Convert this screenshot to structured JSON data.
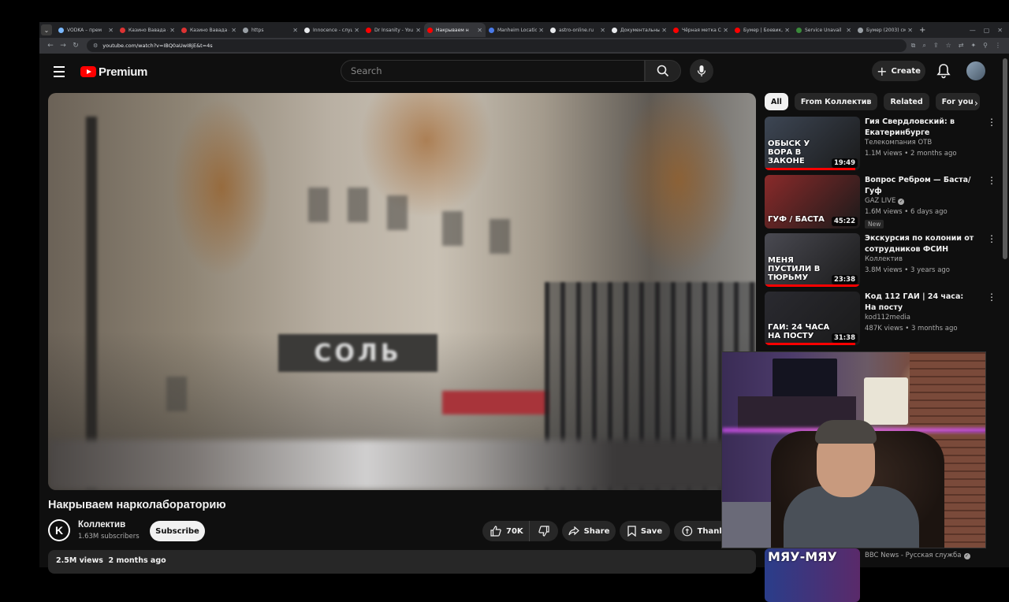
{
  "browser": {
    "tabs": [
      {
        "label": "VODKA – прем",
        "color": "#7ab8ff",
        "active": false
      },
      {
        "label": "Казино Вавада –",
        "color": "#d33",
        "active": false
      },
      {
        "label": "Казино Вавада –",
        "color": "#d33",
        "active": false
      },
      {
        "label": "https",
        "color": "#9aa0a6",
        "active": false
      },
      {
        "label": "Innocence - слуш",
        "color": "#e8eaed",
        "active": false
      },
      {
        "label": "Dr Insanity - You",
        "color": "#f00",
        "active": false
      },
      {
        "label": "Накрываем н",
        "color": "#f00",
        "active": true
      },
      {
        "label": "Manheim Locatio",
        "color": "#4a7ae8",
        "active": false
      },
      {
        "label": "astro-online.ru",
        "color": "#e8eaed",
        "active": false
      },
      {
        "label": "Документальны",
        "color": "#e8eaed",
        "active": false
      },
      {
        "label": "Чёрная метка С",
        "color": "#f00",
        "active": false
      },
      {
        "label": "Бумер | Боевик,",
        "color": "#f00",
        "active": false
      },
      {
        "label": "Service Unavail",
        "color": "#3a8a3a",
        "active": false
      },
      {
        "label": "Бумер (2003) см",
        "color": "#9aa0a6",
        "active": false
      }
    ],
    "url": "youtube.com/watch?v=IBQ0aUwI8jE&t=4s"
  },
  "header": {
    "logo_text": "Premium",
    "search_placeholder": "Search",
    "create_label": "Create"
  },
  "video": {
    "title": "Накрываем нарколабораторию",
    "sign_text": "СОЛЬ",
    "channel": "Коллектив",
    "channel_initial": "K",
    "subscribers": "1.63M subscribers",
    "subscribe_label": "Subscribe",
    "likes": "70K",
    "share_label": "Share",
    "save_label": "Save",
    "thanks_label": "Thanks",
    "views": "2.5M views",
    "age": "2 months ago"
  },
  "chips": [
    "All",
    "From Коллектив",
    "Related",
    "For you"
  ],
  "recommendations": [
    {
      "title": "Гия Свердловский: в Екатеринбурге задержали ...",
      "channel": "Телекомпания ОТВ",
      "verified": false,
      "views": "1.1M views",
      "age": "2 months ago",
      "duration": "19:49",
      "caption": "ОБЫСК У ВОРА В ЗАКОНЕ",
      "new": false,
      "thumb_color": "#3d4654",
      "progress": 0.95
    },
    {
      "title": "Вопрос Ребром — Баста/Гуф",
      "channel": "GAZ LIVE",
      "verified": true,
      "views": "1.6M views",
      "age": "6 days ago",
      "duration": "45:22",
      "caption": "ГУФ / БАСТА",
      "new": true,
      "new_label": "New",
      "thumb_color": "#8a2a2a",
      "progress": 0
    },
    {
      "title": "Экскурсия по колонии от сотрудников ФСИН",
      "channel": "Коллектив",
      "verified": false,
      "views": "3.8M views",
      "age": "3 years ago",
      "duration": "23:38",
      "caption": "МЕНЯ ПУСТИЛИ В ТЮРЬМУ",
      "new": false,
      "thumb_color": "#4a4a52",
      "progress": 1.0
    },
    {
      "title": "Код 112 ГАИ | 24 часа: На посту",
      "channel": "kod112media",
      "verified": false,
      "views": "487K views",
      "age": "3 months ago",
      "duration": "31:38",
      "caption": "ГАИ: 24 ЧАСА НА ПОСТУ",
      "new": false,
      "thumb_color": "#2a2a30",
      "progress": 0.95
    }
  ],
  "last_rec": {
    "caption": "МЯУ-МЯУ",
    "channel": "BBC News - Русская служба",
    "verified": true
  }
}
